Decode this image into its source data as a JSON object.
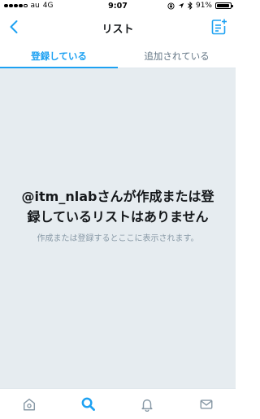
{
  "status_bar": {
    "carrier": "au",
    "network": "4G",
    "time": "9:07",
    "battery": "91%",
    "battery_level": 0.91
  },
  "nav": {
    "title": "リスト"
  },
  "tabs": [
    {
      "label": "登録している",
      "active": true
    },
    {
      "label": "追加されている",
      "active": false
    }
  ],
  "empty_state": {
    "title": "@itm_nlabさんが作成または登録しているリストはありません",
    "subtitle": "作成または登録するとここに表示されます。"
  },
  "tab_bar": {
    "icons": [
      "home-icon",
      "search-icon",
      "notifications-icon",
      "messages-icon"
    ]
  },
  "colors": {
    "accent": "#1da1f2",
    "background": "#e6ecf0",
    "inactive": "#657786"
  }
}
